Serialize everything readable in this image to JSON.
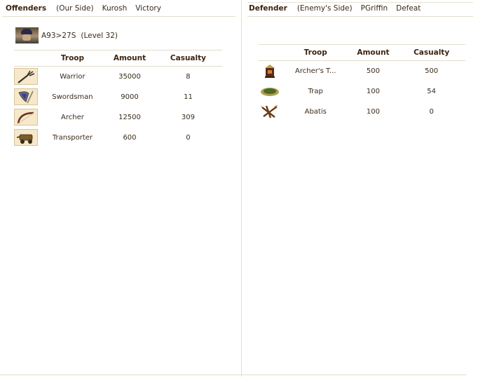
{
  "offender": {
    "side_title": "Offenders",
    "side_note": "(Our Side)",
    "player": "Kurosh",
    "result": "Victory",
    "hero": {
      "name": "A93>27S",
      "level": "(Level 32)"
    },
    "columns": [
      "Troop",
      "Amount",
      "Casualty"
    ],
    "rows": [
      {
        "icon": "pitchfork-icon",
        "troop": "Warrior",
        "amount": "35000",
        "casualty": "8"
      },
      {
        "icon": "shield-sword-icon",
        "troop": "Swordsman",
        "amount": "9000",
        "casualty": "11"
      },
      {
        "icon": "bow-icon",
        "troop": "Archer",
        "amount": "12500",
        "casualty": "309"
      },
      {
        "icon": "wagon-icon",
        "troop": "Transporter",
        "amount": "600",
        "casualty": "0"
      }
    ]
  },
  "defender": {
    "side_title": "Defender",
    "side_note": "(Enemy's Side)",
    "player": "PGriffin",
    "result": "Defeat",
    "columns": [
      "Troop",
      "Amount",
      "Casualty"
    ],
    "rows": [
      {
        "icon": "archer-tower-icon",
        "troop": "Archer's T...",
        "amount": "500",
        "casualty": "500"
      },
      {
        "icon": "trap-icon",
        "troop": "Trap",
        "amount": "100",
        "casualty": "54"
      },
      {
        "icon": "abatis-icon",
        "troop": "Abatis",
        "amount": "100",
        "casualty": "0"
      }
    ]
  }
}
